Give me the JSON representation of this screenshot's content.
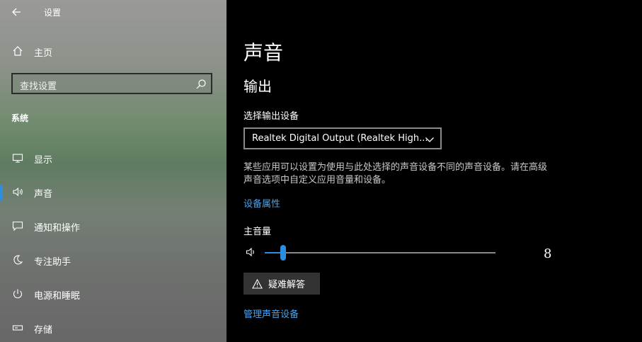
{
  "window": {
    "title": "设置"
  },
  "sidebar": {
    "home_label": "主页",
    "search_placeholder": "查找设置",
    "section_title": "系统",
    "items": [
      {
        "label": "显示",
        "icon": "monitor-icon",
        "active": false
      },
      {
        "label": "声音",
        "icon": "speaker-icon",
        "active": true
      },
      {
        "label": "通知和操作",
        "icon": "notification-icon",
        "active": false
      },
      {
        "label": "专注助手",
        "icon": "moon-icon",
        "active": false
      },
      {
        "label": "电源和睡眠",
        "icon": "power-icon",
        "active": false
      },
      {
        "label": "存储",
        "icon": "storage-icon",
        "active": false
      }
    ]
  },
  "main": {
    "title": "声音",
    "output_heading": "输出",
    "output_device_label": "选择输出设备",
    "output_device_value": "Realtek Digital Output (Realtek High...",
    "description": "某些应用可以设置为使用与此处选择的声音设备不同的声音设备。请在高级声音选项中自定义应用音量和设备。",
    "device_properties_link": "设备属性",
    "master_volume_label": "主音量",
    "volume": 8,
    "troubleshoot_label": "疑难解答",
    "manage_devices_link": "管理声音设备"
  },
  "colors": {
    "accent": "#2d8de0",
    "link": "#4aa3ea"
  }
}
